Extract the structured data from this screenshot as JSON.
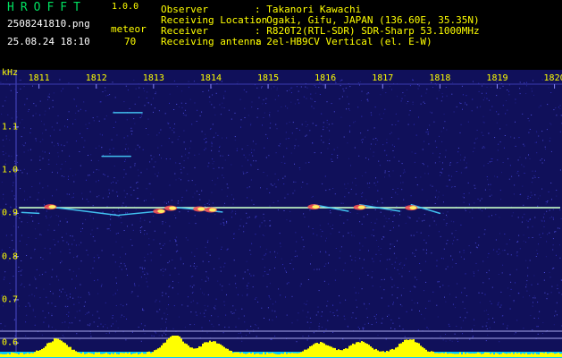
{
  "header": {
    "title": "HROFFT",
    "version": "1.0.0",
    "filename": "2508241810.png",
    "datetime": "25.08.24 18:10",
    "meteor_label": "meteor",
    "meteor_count": "70",
    "info": [
      {
        "key": "Observer",
        "value": ": Takanori Kawachi"
      },
      {
        "key": "Receiving Location",
        "value": ": Ogaki, Gifu, JAPAN (136.60E, 35.35N)"
      },
      {
        "key": "Receiver",
        "value": ": R820T2(RTL-SDR) SDR-Sharp 53.1000MHz"
      },
      {
        "key": "Receiving antenna",
        "value": ": 2el-HB9CV Vertical (el. E-W)"
      }
    ]
  },
  "colors": {
    "background": "#10105a",
    "label": "#ffff00",
    "title": "#00e060",
    "carrier": "#c8ffc8",
    "histogram": "#ffff00"
  },
  "chart_data": {
    "type": "heatmap",
    "ylabel": "kHz",
    "x_ticks": [
      "1811",
      "1812",
      "1813",
      "1814",
      "1815",
      "1816",
      "1817",
      "1818",
      "1819",
      "1820"
    ],
    "y_ticks": [
      "1.1",
      "1.0",
      "0.9",
      "0.8",
      "0.7",
      "0.6"
    ],
    "x_range": [
      1810.6,
      1820.1
    ],
    "y_range": [
      0.59,
      1.195
    ],
    "carrier_khz": 0.913,
    "echoes": [
      {
        "t": 1811.2,
        "f": 0.915
      },
      {
        "t": 1813.1,
        "f": 0.905
      },
      {
        "t": 1813.3,
        "f": 0.912
      },
      {
        "t": 1813.8,
        "f": 0.91
      },
      {
        "t": 1814.0,
        "f": 0.908
      },
      {
        "t": 1815.8,
        "f": 0.915
      },
      {
        "t": 1816.6,
        "f": 0.914
      },
      {
        "t": 1817.5,
        "f": 0.913
      }
    ],
    "streaks": [
      {
        "t": 1811.2,
        "f": 0.915,
        "t2": 1812.4,
        "f2": 0.895
      },
      {
        "t": 1812.4,
        "f": 0.896,
        "t2": 1813.1,
        "f2": 0.905
      },
      {
        "t": 1813.3,
        "f": 0.915,
        "t2": 1814.2,
        "f2": 0.903
      },
      {
        "t": 1815.8,
        "f": 0.92,
        "t2": 1816.4,
        "f2": 0.905
      },
      {
        "t": 1816.6,
        "f": 0.92,
        "t2": 1817.3,
        "f2": 0.905
      },
      {
        "t": 1817.5,
        "f": 0.92,
        "t2": 1818.0,
        "f2": 0.9
      },
      {
        "t": 1812.1,
        "f": 1.032,
        "t2": 1812.6,
        "f2": 1.032
      },
      {
        "t": 1812.3,
        "f": 1.133,
        "t2": 1812.8,
        "f2": 1.133
      },
      {
        "t": 1810.7,
        "f": 0.902,
        "t2": 1811.0,
        "f2": 0.9
      }
    ],
    "activity": [
      {
        "t": 1811.3,
        "level": 0.8
      },
      {
        "t": 1813.35,
        "level": 1.0
      },
      {
        "t": 1814.0,
        "level": 0.7
      },
      {
        "t": 1815.9,
        "level": 0.6
      },
      {
        "t": 1816.6,
        "level": 0.65
      },
      {
        "t": 1817.45,
        "level": 0.8
      }
    ]
  }
}
